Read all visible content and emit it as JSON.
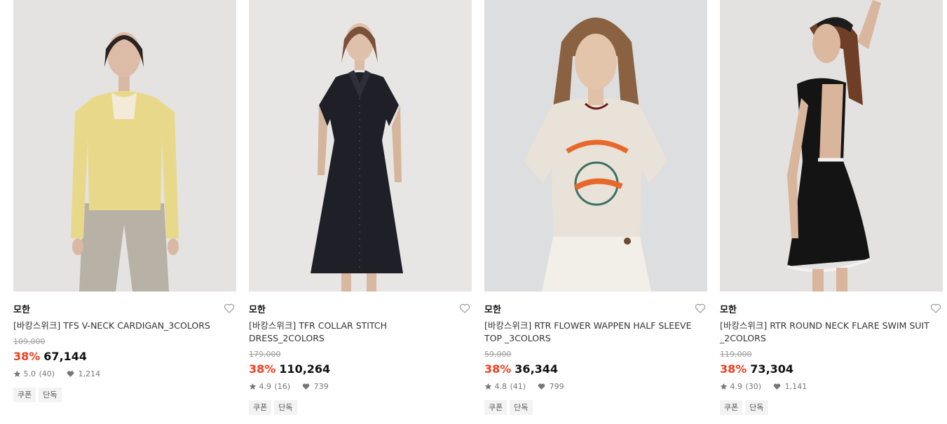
{
  "products": [
    {
      "brand": "모한",
      "name": "[바캉스위크] TFS V-NECK CARDIGAN_3COLORS",
      "original_price": "109,000",
      "discount": "38%",
      "price": "67,144",
      "rating": "5.0",
      "reviews": "(40)",
      "likes": "1,214",
      "tags": [
        "쿠폰",
        "단독"
      ]
    },
    {
      "brand": "모한",
      "name": "[바캉스위크] TFR COLLAR STITCH DRESS_2COLORS",
      "original_price": "179,000",
      "discount": "38%",
      "price": "110,264",
      "rating": "4.9",
      "reviews": "(16)",
      "likes": "739",
      "tags": [
        "쿠폰",
        "단독"
      ]
    },
    {
      "brand": "모한",
      "name": "[바캉스위크] RTR FLOWER WAPPEN HALF SLEEVE TOP _3COLORS",
      "original_price": "59,000",
      "discount": "38%",
      "price": "36,344",
      "rating": "4.8",
      "reviews": "(41)",
      "likes": "799",
      "tags": [
        "쿠폰",
        "단독"
      ]
    },
    {
      "brand": "모한",
      "name": "[바캉스위크] RTR ROUND NECK FLARE SWIM SUIT _2COLORS",
      "original_price": "119,000",
      "discount": "38%",
      "price": "73,304",
      "rating": "4.9",
      "reviews": "(30)",
      "likes": "1,141",
      "tags": [
        "쿠폰",
        "단독"
      ]
    }
  ],
  "colors": {
    "discount": "#ef3e1c",
    "tag_bg": "#f3f3f3",
    "muted": "#9a9a9a"
  },
  "icons": [
    "heart-outline-icon",
    "star-icon",
    "heart-filled-icon"
  ]
}
